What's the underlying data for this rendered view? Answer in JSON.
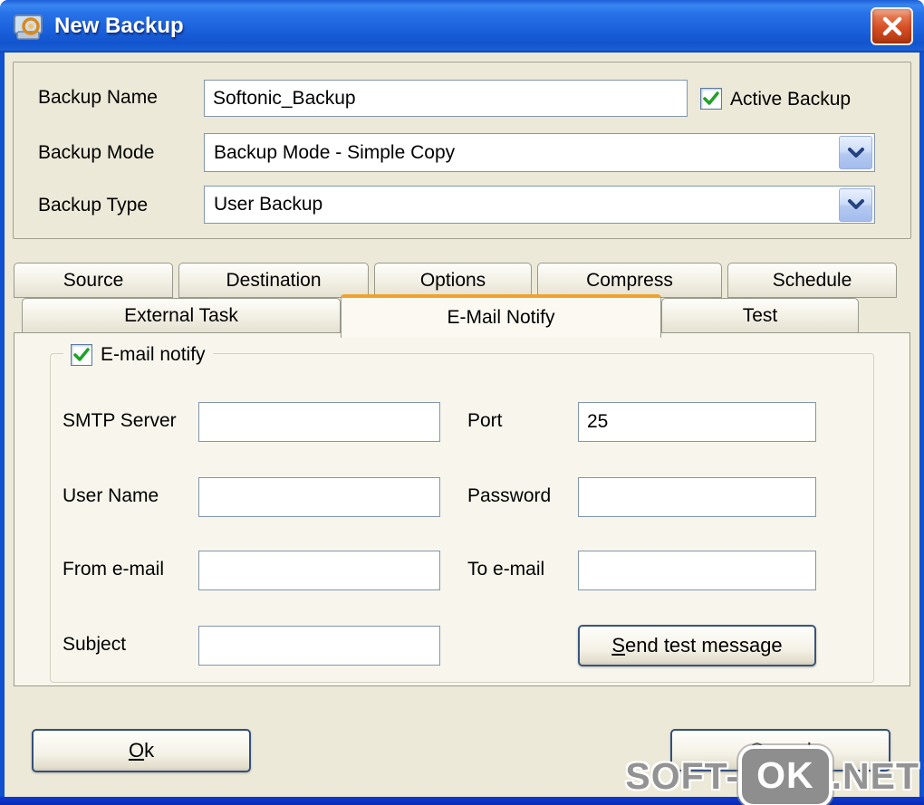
{
  "colors": {
    "titlebar_blue": "#1b62dd",
    "body_beige": "#ece9d8",
    "panel_bg": "#f8f6ec",
    "active_tab_orange": "#f0a22c",
    "input_border": "#8296ab",
    "check_green": "#1ea226",
    "close_red": "#d54e24",
    "bottom_frame_blue": "#0a2bb4"
  },
  "window": {
    "title": "New Backup"
  },
  "icons": {
    "app": "backup-disk-icon",
    "close": "✕",
    "check": "✓",
    "chevron_down": "v"
  },
  "form": {
    "backup_name": {
      "label": "Backup Name",
      "value": "Softonic_Backup"
    },
    "active_backup": {
      "label": "Active Backup",
      "checked": true
    },
    "backup_mode": {
      "label": "Backup Mode",
      "value": "Backup Mode - Simple Copy"
    },
    "backup_type": {
      "label": "Backup Type",
      "value": "User Backup"
    }
  },
  "tabs": {
    "row1": [
      "Source",
      "Destination",
      "Options",
      "Compress",
      "Schedule"
    ],
    "row2": [
      "External Task",
      "E-Mail Notify",
      "Test"
    ],
    "active": "E-Mail Notify"
  },
  "email": {
    "group": {
      "label": "E-mail notify",
      "checked": true
    },
    "smtp": {
      "label": "SMTP Server",
      "value": ""
    },
    "port": {
      "label": "Port",
      "value": "25"
    },
    "user": {
      "label": "User Name",
      "value": ""
    },
    "password": {
      "label": "Password",
      "value": ""
    },
    "from": {
      "label": "From e-mail",
      "value": ""
    },
    "to": {
      "label": "To e-mail",
      "value": ""
    },
    "subject": {
      "label": "Subject",
      "value": ""
    },
    "send_test_label": "Send test message"
  },
  "footer": {
    "ok_label": "Ok",
    "cancel_label": "Cancel"
  },
  "watermark": {
    "prefix": "SOFT-",
    "badge": "OK",
    "suffix": ".NET"
  }
}
